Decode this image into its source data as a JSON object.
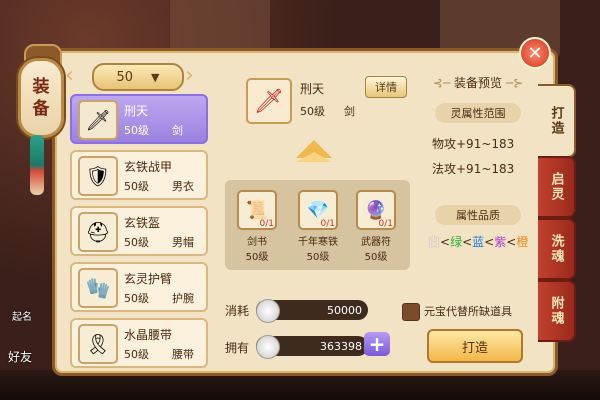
{
  "sign": {
    "char1": "装",
    "char2": "备"
  },
  "level": {
    "value": "50"
  },
  "close_symbol": "✕",
  "list": [
    {
      "name": "刑天",
      "level": "50级",
      "type": "剑",
      "icon": "sword-icon",
      "glyph": "🗡",
      "selected": true
    },
    {
      "name": "玄铁战甲",
      "level": "50级",
      "type": "男衣",
      "icon": "armor-icon",
      "glyph": "🛡"
    },
    {
      "name": "玄铁盔",
      "level": "50级",
      "type": "男帽",
      "icon": "helmet-icon",
      "glyph": "⛑"
    },
    {
      "name": "玄灵护臂",
      "level": "50级",
      "type": "护腕",
      "icon": "bracer-icon",
      "glyph": "🧤"
    },
    {
      "name": "水晶腰带",
      "level": "50级",
      "type": "腰带",
      "icon": "belt-icon",
      "glyph": "🎗"
    }
  ],
  "current": {
    "name": "刑天",
    "level": "50级",
    "type": "剑",
    "detail_label": "详情"
  },
  "materials": [
    {
      "name": "剑书",
      "level": "50级",
      "count": "0/1",
      "icon": "book-icon",
      "glyph": "📜"
    },
    {
      "name": "千年寒铁",
      "level": "50级",
      "count": "0/1",
      "icon": "ice-iron-icon",
      "glyph": "💎"
    },
    {
      "name": "武器符",
      "level": "50级",
      "count": "0/1",
      "icon": "talisman-icon",
      "glyph": "🔮"
    }
  ],
  "cost": {
    "consume_label": "消耗",
    "consume_value": "50000",
    "own_label": "拥有",
    "own_value": "363398"
  },
  "preview": {
    "title": "装备预览",
    "spirit_range_label": "灵属性范围",
    "stat1": "物攻+91~183",
    "stat2": "法攻+91~183",
    "quality_label": "属性品质",
    "quality_parts": [
      {
        "text": "白",
        "color": "#ffffff"
      },
      {
        "text": "<",
        "color": "#4a2a12"
      },
      {
        "text": "绿",
        "color": "#2fae35"
      },
      {
        "text": "<",
        "color": "#4a2a12"
      },
      {
        "text": "蓝",
        "color": "#1f7fe0"
      },
      {
        "text": "<",
        "color": "#4a2a12"
      },
      {
        "text": "紫",
        "color": "#b23ad6"
      },
      {
        "text": "<",
        "color": "#4a2a12"
      },
      {
        "text": "橙",
        "color": "#ef8a17"
      }
    ],
    "yuanbao_label": "元宝代替所缺道具",
    "craft_label": "打造"
  },
  "tabs": [
    {
      "label": "打造",
      "active": true
    },
    {
      "label": "启灵",
      "active": false
    },
    {
      "label": "洗魂",
      "active": false
    },
    {
      "label": "附魂",
      "active": false
    }
  ],
  "left_side": {
    "label1": "起名",
    "label2": "好友"
  }
}
